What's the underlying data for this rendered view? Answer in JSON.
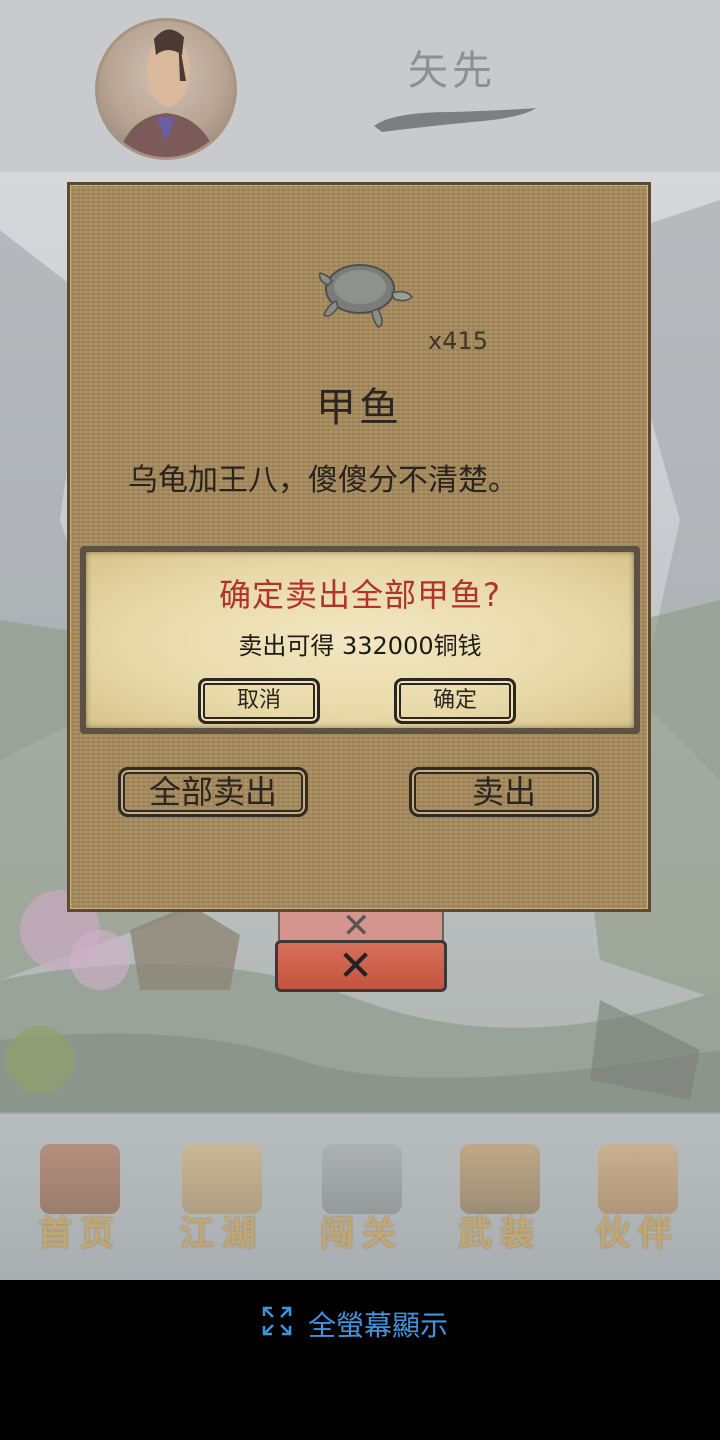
{
  "header": {
    "player_name": "矢先"
  },
  "dialog": {
    "item_name": "甲鱼",
    "item_count": "x415",
    "item_description": "乌龟加王八，傻傻分不清楚。",
    "sell_all_label": "全部卖出",
    "sell_label": "卖出",
    "close_symbol": "✕"
  },
  "confirm": {
    "title": "确定卖出全部甲鱼?",
    "message": "卖出可得 332000铜钱",
    "cancel_label": "取消",
    "ok_label": "确定"
  },
  "nav": {
    "items": [
      {
        "label": "首页",
        "icon": "house-icon"
      },
      {
        "label": "江湖",
        "icon": "scroll-icon"
      },
      {
        "label": "闯关",
        "icon": "swords-icon"
      },
      {
        "label": "武装",
        "icon": "armor-icon"
      },
      {
        "label": "伙伴",
        "icon": "partners-icon"
      }
    ]
  },
  "ad_bar": {
    "fullscreen_label": "全螢幕顯示"
  },
  "colors": {
    "confirm_title": "#b3332a",
    "fullscreen_link": "#3d95e0",
    "close_button": "#c4533f"
  }
}
